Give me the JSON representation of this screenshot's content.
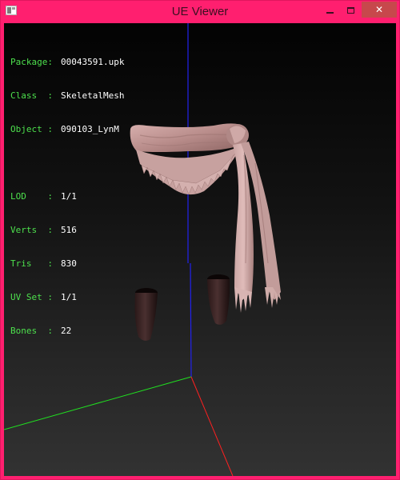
{
  "window": {
    "title": "UE Viewer",
    "buttons": {
      "minimize_icon": "minimize-icon",
      "maximize_icon": "maximize-icon",
      "close_label": "✕"
    },
    "accent_color": "#ff1f6f",
    "close_color": "#c7484c"
  },
  "info": {
    "package": {
      "label": "Package:",
      "value": "00043591.upk"
    },
    "class": {
      "label": "Class  :",
      "value": "SkeletalMesh"
    },
    "object": {
      "label": "Object :",
      "value": "090103_LynM"
    },
    "lod": {
      "label": "LOD    :",
      "value": "1/1"
    },
    "verts": {
      "label": "Verts  :",
      "value": "516"
    },
    "tris": {
      "label": "Tris   :",
      "value": "830"
    },
    "uvset": {
      "label": "UV Set :",
      "value": "1/1"
    },
    "bones": {
      "label": "Bones  :",
      "value": "22"
    }
  },
  "viewport": {
    "axis_colors": {
      "x": "#ff2020",
      "y": "#20e020",
      "z": "#2020ff"
    },
    "background": "dark-gradient"
  }
}
